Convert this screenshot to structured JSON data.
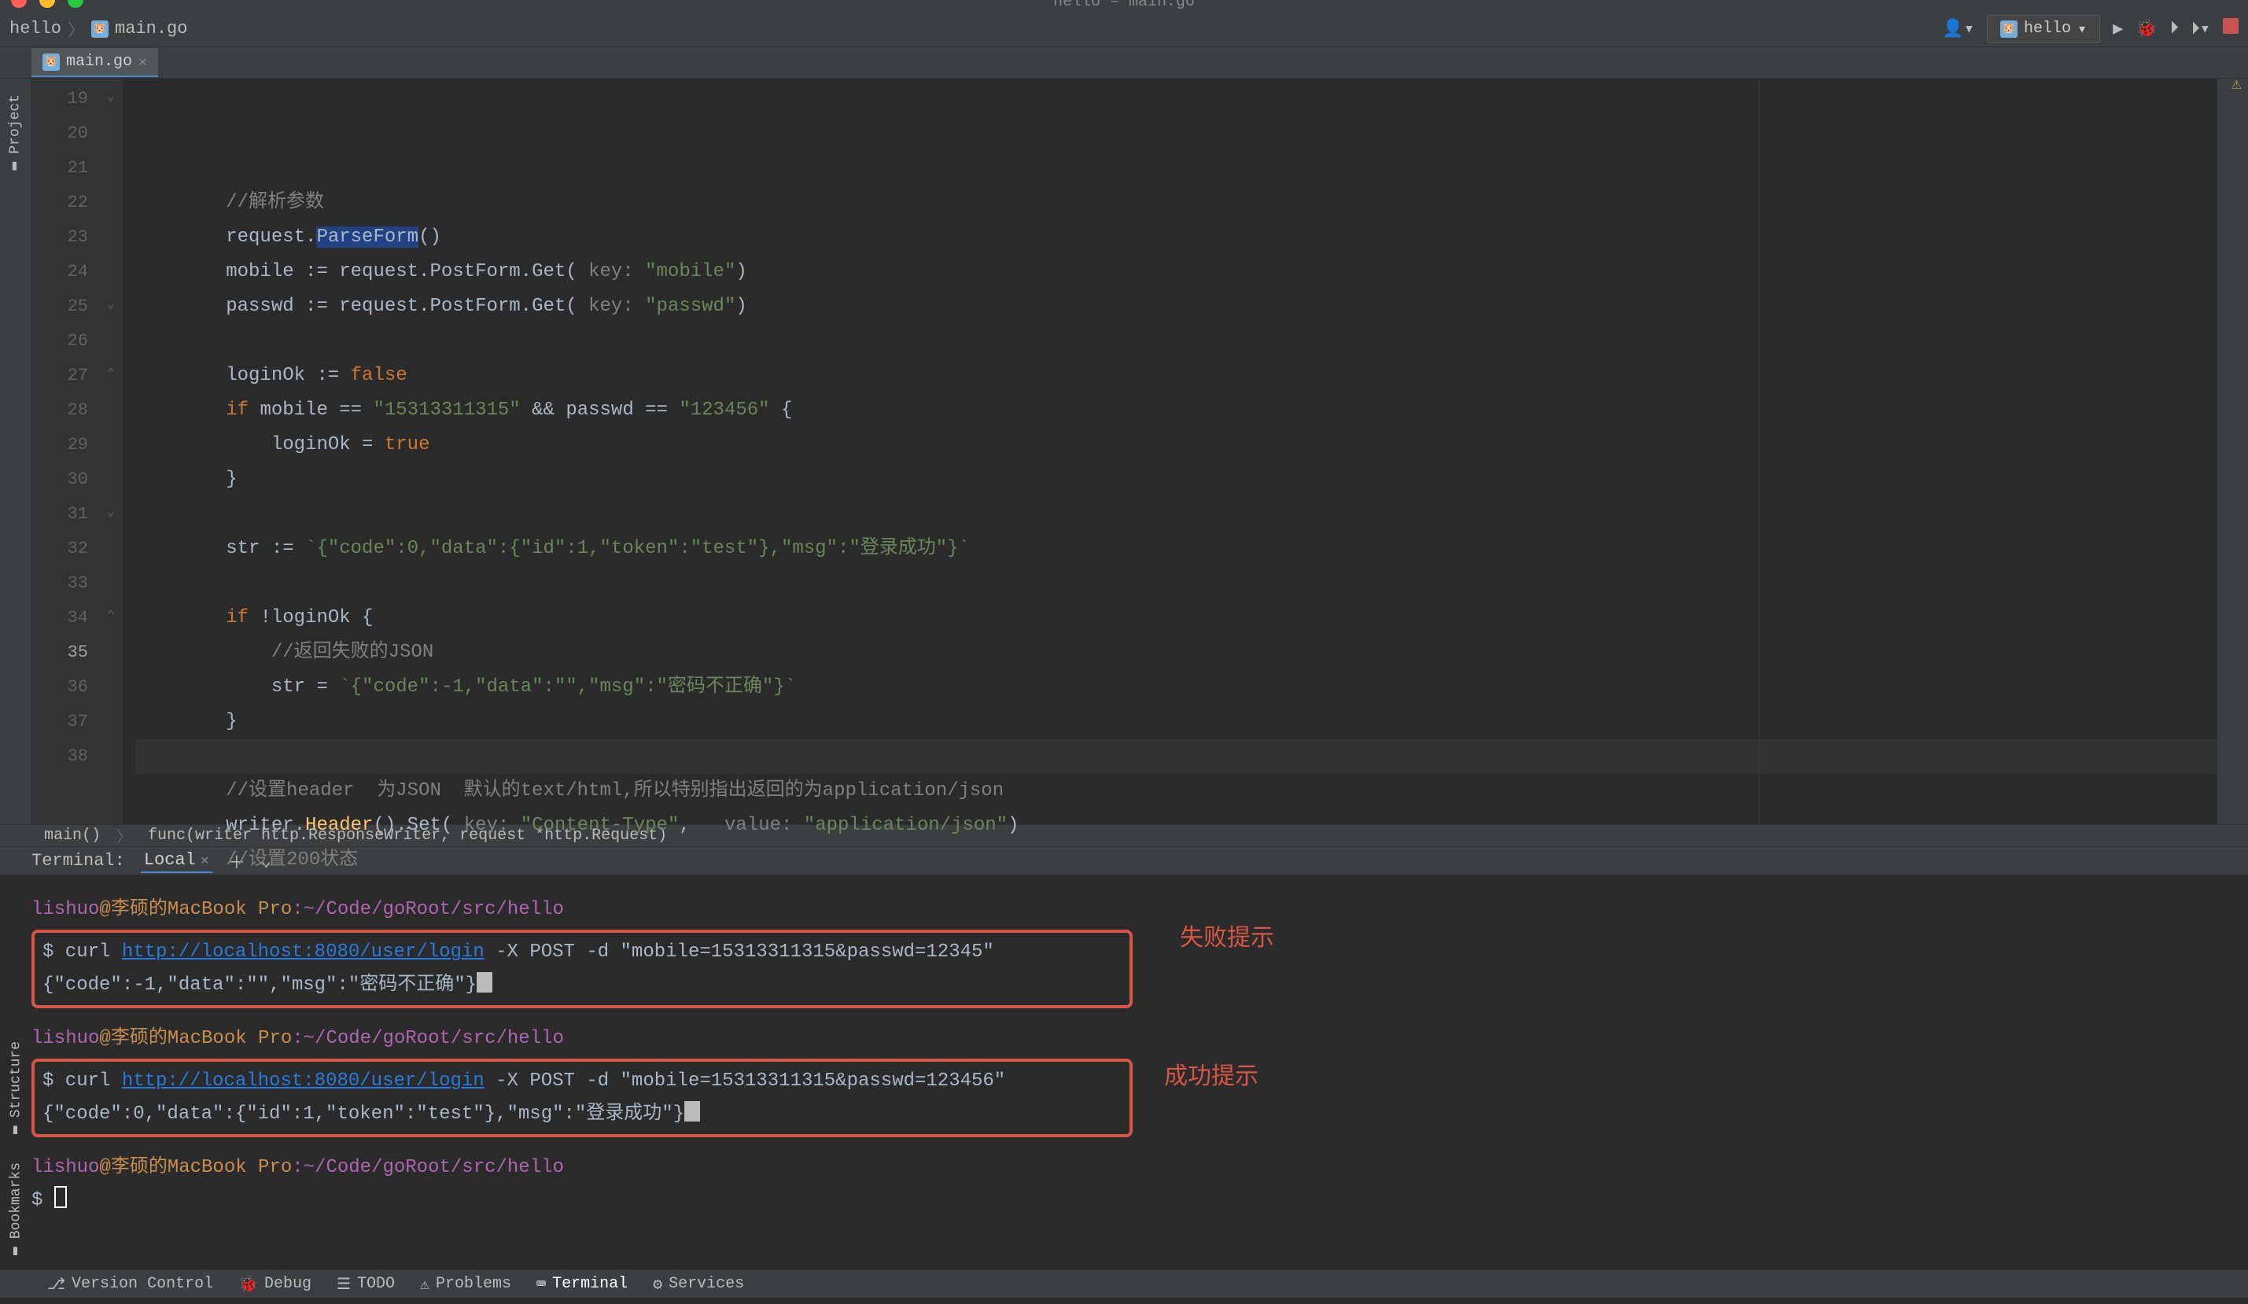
{
  "window": {
    "title": "hello – main.go"
  },
  "breadcrumb": {
    "project": "hello",
    "file": "main.go"
  },
  "toolbar": {
    "runconfig_label": "hello"
  },
  "tabs": [
    {
      "icon": "go",
      "label": "main.go"
    }
  ],
  "gutter_start": 19,
  "gutter_end": 38,
  "gutter_current": 35,
  "code_breadcrumb": {
    "fn1": "main()",
    "fn2": "func(writer http.ResponseWriter, request *http.Request)"
  },
  "code": {
    "l19": "//解析参数",
    "l20_a": "request.",
    "l20_b": "ParseForm",
    "l20_c": "()",
    "l21_a": "mobile := request.PostForm.Get(",
    "l21_k": " key: ",
    "l21_s": "\"mobile\"",
    "l21_z": ")",
    "l22_a": "passwd := request.PostForm.Get(",
    "l22_k": " key: ",
    "l22_s": "\"passwd\"",
    "l22_z": ")",
    "l24_a": "loginOk := ",
    "l24_b": "false",
    "l25_a": "if ",
    "l25_b": "mobile == ",
    "l25_c": "\"15313311315\"",
    "l25_d": " && passwd == ",
    "l25_e": "\"123456\"",
    "l25_f": " {",
    "l26_a": "loginOk = ",
    "l26_b": "true",
    "l27": "}",
    "l29_a": "str := ",
    "l29_b": "`{\"code\":0,\"data\":{\"id\":1,\"token\":\"test\"},\"msg\":\"登录成功\"}`",
    "l31_a": "if ",
    "l31_b": "!loginOk {",
    "l32": "//返回失败的JSON",
    "l33_a": "str = ",
    "l33_b": "`{\"code\":-1,\"data\":\"\",\"msg\":\"密码不正确\"}`",
    "l34": "}",
    "l36": "//设置header  为JSON  默认的text/html,所以特别指出返回的为application/json",
    "l37_a": "writer.",
    "l37_b": "Header",
    "l37_c": "().Set(",
    "l37_k1": " key: ",
    "l37_s1": "\"Content-Type\"",
    "l37_cm": ",  ",
    "l37_k2": " value: ",
    "l37_s2": "\"application/json\"",
    "l37_z": ")",
    "l38": "//设置200状态"
  },
  "terminal": {
    "header_label": "Terminal:",
    "tab_label": "Local",
    "prompt_user": "lishuo",
    "prompt_host": "@李硕的MacBook Pro",
    "prompt_path": ":~/Code/goRoot/src/hello",
    "cmd1_a": "$ curl ",
    "cmd1_url": "http://localhost:8080/user/login",
    "cmd1_b": " -X POST -d \"mobile=15313311315&passwd=12345\"",
    "resp1": "{\"code\":-1,\"data\":\"\",\"msg\":\"密码不正确\"}",
    "annot1": "失败提示",
    "cmd2_a": "$ curl ",
    "cmd2_url": "http://localhost:8080/user/login",
    "cmd2_b": " -X POST -d \"mobile=15313311315&passwd=123456\"",
    "resp2": "{\"code\":0,\"data\":{\"id\":1,\"token\":\"test\"},\"msg\":\"登录成功\"}",
    "annot2": "成功提示",
    "prompt3": "$ "
  },
  "sidebars": {
    "left_top": "Project",
    "left_bot": "Structure",
    "left_bot2": "Bookmarks"
  },
  "bottom_toolwindows": [
    {
      "icon": "git-icon",
      "label": "Version Control"
    },
    {
      "icon": "debug-icon",
      "label": "Debug"
    },
    {
      "icon": "todo-icon",
      "label": "TODO"
    },
    {
      "icon": "warn-icon",
      "label": "Problems"
    },
    {
      "icon": "term-icon",
      "label": "Terminal",
      "active": true
    },
    {
      "icon": "svc-icon",
      "label": "Services"
    }
  ]
}
